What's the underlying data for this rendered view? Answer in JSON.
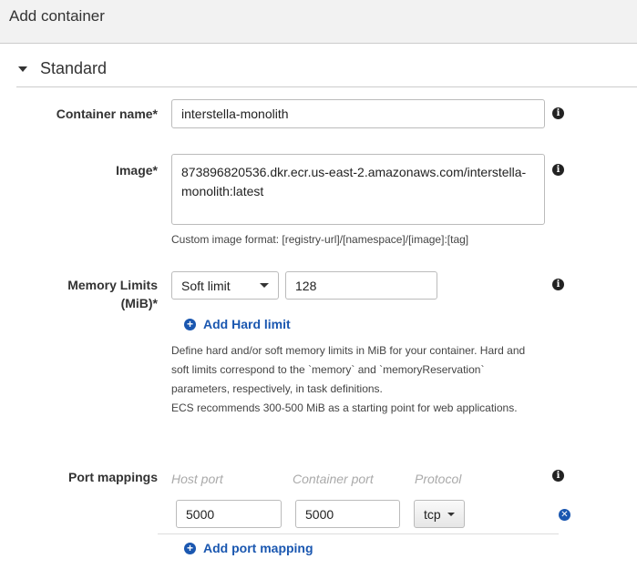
{
  "header": {
    "title": "Add container"
  },
  "section": {
    "title": "Standard"
  },
  "container_name": {
    "label": "Container name*",
    "value": "interstella-monolith"
  },
  "image": {
    "label": "Image*",
    "value": "873896820536.dkr.ecr.us-east-2.amazonaws.com/interstella-monolith:latest",
    "help": "Custom image format: [registry-url]/[namespace]/[image]:[tag]"
  },
  "memory": {
    "label_line1": "Memory Limits",
    "label_line2": "(MiB)*",
    "limit_type": "Soft limit",
    "value": "128",
    "add_hard_limit": "Add Hard limit",
    "help": [
      "Define hard and/or soft memory limits in MiB for your container. Hard and",
      "soft limits correspond to the `memory` and `memoryReservation`",
      "parameters, respectively, in task definitions.",
      "ECS recommends 300-500 MiB as a starting point for web applications."
    ]
  },
  "ports": {
    "label": "Port mappings",
    "host_placeholder": "Host port",
    "container_placeholder": "Container port",
    "protocol_placeholder": "Protocol",
    "host_port": "5000",
    "container_port": "5000",
    "protocol": "tcp",
    "add_label": "Add port mapping"
  }
}
